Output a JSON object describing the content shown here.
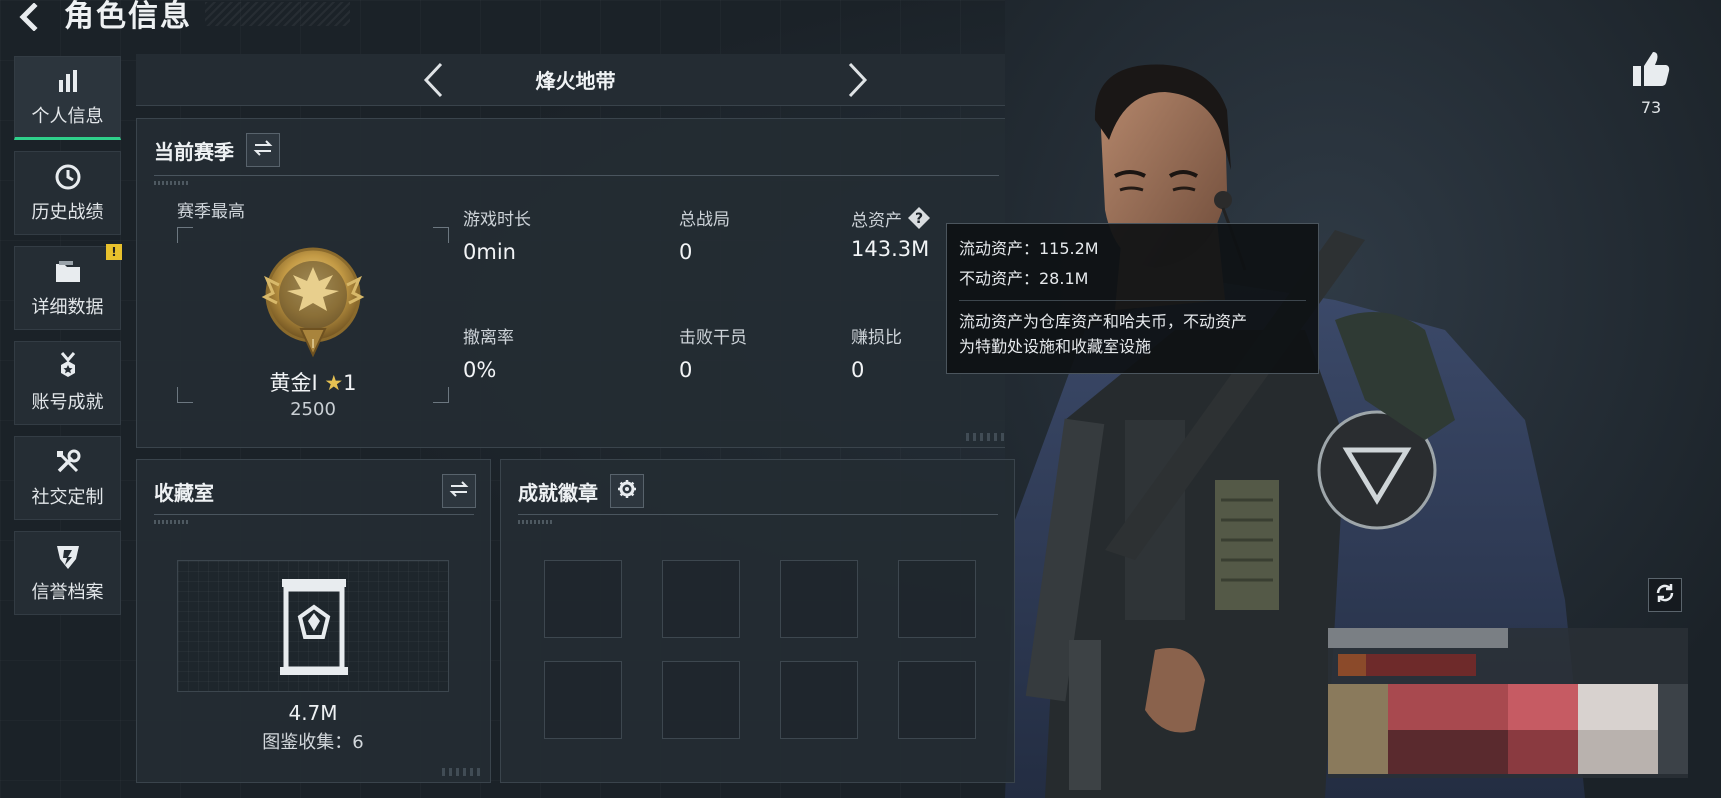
{
  "header": {
    "title": "角色信息"
  },
  "sidebar": {
    "items": [
      {
        "label": "个人信息",
        "icon": "bar-chart-icon",
        "active": true
      },
      {
        "label": "历史战绩",
        "icon": "clock-icon"
      },
      {
        "label": "详细数据",
        "icon": "folder-icon",
        "alert": "!"
      },
      {
        "label": "账号成就",
        "icon": "medal-icon"
      },
      {
        "label": "社交定制",
        "icon": "tools-icon"
      },
      {
        "label": "信誉档案",
        "icon": "shield-icon"
      }
    ]
  },
  "mode": {
    "title": "烽火地带"
  },
  "season": {
    "title": "当前赛季",
    "best_label": "赛季最高",
    "rank_name": "黄金I",
    "rank_star_count": "1",
    "rank_points": "2500",
    "stats": [
      {
        "label": "游戏时长",
        "value": "0min"
      },
      {
        "label": "总战局",
        "value": "0"
      },
      {
        "label": "总资产",
        "value": "143.3M"
      },
      {
        "label": "撤离率",
        "value": "0%"
      },
      {
        "label": "击败干员",
        "value": "0"
      },
      {
        "label": "赚损比",
        "value": "0"
      }
    ]
  },
  "tooltip": {
    "liquid": "流动资产：115.2M",
    "fixed": "不动资产：28.1M",
    "note_line1": "流动资产为仓库资产和哈夫币，不动资产",
    "note_line2": "为特勤处设施和收藏室设施"
  },
  "collection": {
    "title": "收藏室",
    "value": "4.7M",
    "count_text": "图鉴收集：6"
  },
  "achievements": {
    "title": "成就徽章",
    "slots": 8
  },
  "likes": {
    "count": "73"
  },
  "colors": {
    "accent_green": "#2fd08b",
    "alert_yellow": "#e8c12d",
    "gold": "#c9a24a",
    "panel_bg": "#242c33",
    "page_bg": "#1b2228"
  }
}
